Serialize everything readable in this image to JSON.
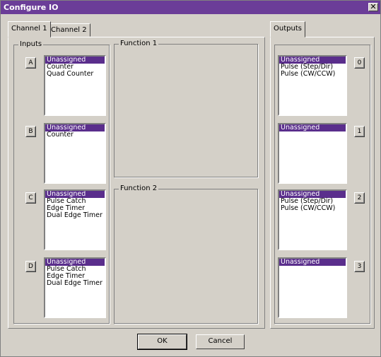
{
  "window": {
    "title": "Configure IO",
    "close_symbol": "✕"
  },
  "tabs": [
    {
      "label": "Channel 1",
      "active": true
    },
    {
      "label": "Channel 2",
      "active": false
    }
  ],
  "outputs_tab": {
    "label": "Outputs"
  },
  "inputs_group": {
    "label": "Inputs"
  },
  "function_groups": [
    {
      "label": "Function 1"
    },
    {
      "label": "Function 2"
    }
  ],
  "inputs": [
    {
      "button": "A",
      "items": [
        "Unassigned",
        "Counter",
        "Quad Counter"
      ],
      "selected": 0
    },
    {
      "button": "B",
      "items": [
        "Unassigned",
        "Counter"
      ],
      "selected": 0
    },
    {
      "button": "C",
      "items": [
        "Unassigned",
        "Pulse Catch",
        "Edge Timer",
        "Dual Edge Timer"
      ],
      "selected": 0
    },
    {
      "button": "D",
      "items": [
        "Unassigned",
        "Pulse Catch",
        "Edge Timer",
        "Dual Edge Timer"
      ],
      "selected": 0
    }
  ],
  "outputs": [
    {
      "button": "0",
      "items": [
        "Unassigned",
        "Pulse (Step/Dir)",
        "Pulse (CW/CCW)"
      ],
      "selected": 0
    },
    {
      "button": "1",
      "items": [
        "Unassigned"
      ],
      "selected": 0
    },
    {
      "button": "2",
      "items": [
        "Unassigned",
        "Pulse (Step/Dir)",
        "Pulse (CW/CCW)"
      ],
      "selected": 0
    },
    {
      "button": "3",
      "items": [
        "Unassigned"
      ],
      "selected": 0
    }
  ],
  "buttons": {
    "ok_label": "OK",
    "cancel_label": "Cancel"
  },
  "colors": {
    "titlebar": "#6b3d98",
    "selection": "#5a2e8c",
    "face": "#d4d0c8"
  }
}
